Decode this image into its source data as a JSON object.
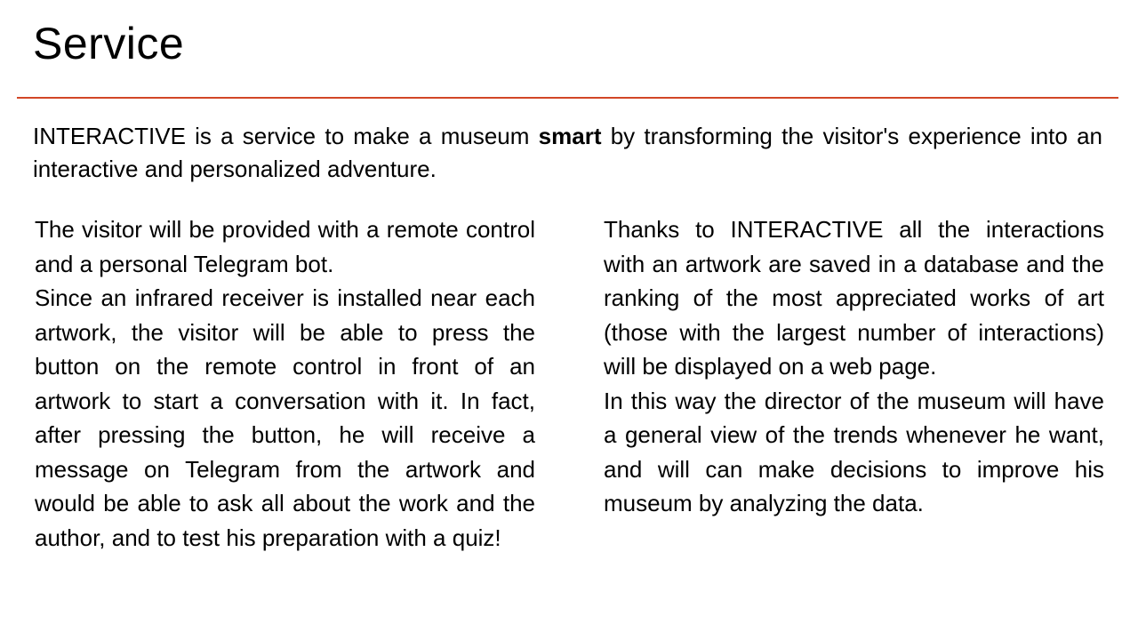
{
  "slide": {
    "title": "Service",
    "accent_color": "#D24726",
    "intro": {
      "before": "INTERACTIVE is a service to make a museum ",
      "emphasis": "smart",
      "after": " by transforming the visitor's experience into an interactive and personalized adventure."
    },
    "left_column": {
      "paragraphs": [
        "The visitor will be provided with a remote control and a personal Telegram bot.",
        "Since an infrared receiver is installed near each artwork, the visitor will be able to press the button on the remote control in front of an artwork to start a conversation with it. In fact, after pressing the button, he will receive a message on Telegram from the artwork and would be able to ask all about the work and the author, and to test his preparation with a quiz!"
      ]
    },
    "right_column": {
      "paragraphs": [
        "Thanks to INTERACTIVE all the interactions with an artwork are saved in a database and the ranking of the most appreciated works of art (those with the largest number of interactions) will be displayed on a web page.",
        "In this way the director of the museum will have a general view of the trends whenever he want, and will can make decisions to improve his museum by analyzing the data."
      ]
    }
  }
}
